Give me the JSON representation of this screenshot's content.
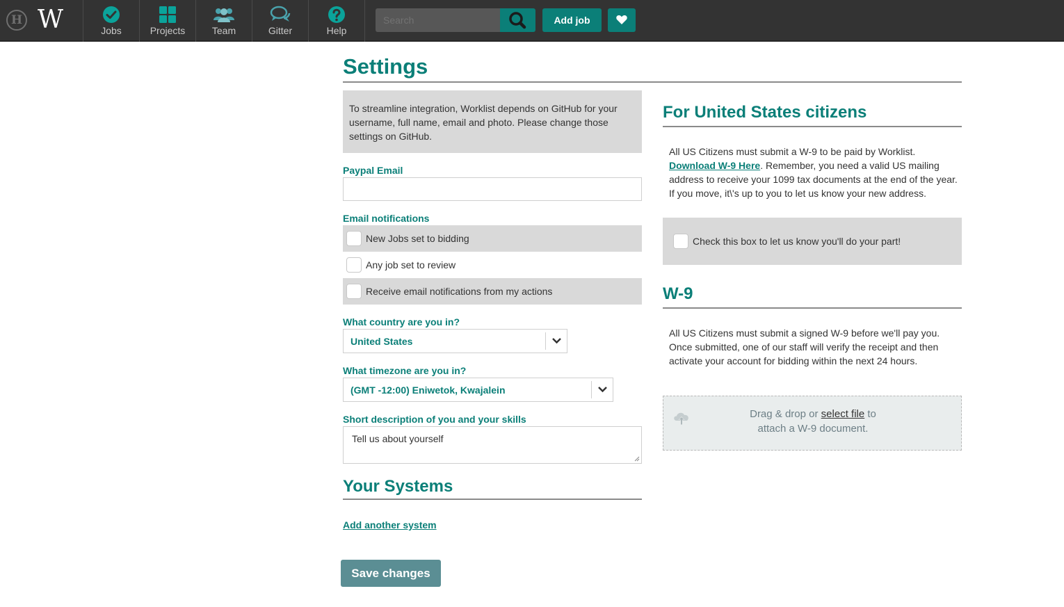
{
  "nav": {
    "items": [
      {
        "label": "Jobs",
        "icon": "check-circle-icon"
      },
      {
        "label": "Projects",
        "icon": "grid-icon"
      },
      {
        "label": "Team",
        "icon": "users-icon"
      },
      {
        "label": "Gitter",
        "icon": "chat-icon"
      },
      {
        "label": "Help",
        "icon": "question-icon"
      }
    ],
    "search_placeholder": "Search",
    "add_job_label": "Add job"
  },
  "colors": {
    "accent": "#0b7f78",
    "topbar": "#333333",
    "save_button": "#5b8e94",
    "panel_gray": "#d9d9d9"
  },
  "settings": {
    "title": "Settings",
    "info_text": "To streamline integration, Worklist depends on GitHub for your username, full name, email and photo. Please change those settings on GitHub.",
    "paypal_label": "Paypal Email",
    "paypal_value": "",
    "email_notifications_label": "Email notifications",
    "notifications": [
      {
        "label": "New Jobs set to bidding",
        "checked": false
      },
      {
        "label": "Any job set to review",
        "checked": false
      },
      {
        "label": "Receive email notifications from my actions",
        "checked": false
      }
    ],
    "country_label": "What country are you in?",
    "country_value": "United States",
    "timezone_label": "What timezone are you in?",
    "timezone_value": "(GMT -12:00) Eniwetok, Kwajalein",
    "skills_label": "Short description of you and your skills",
    "skills_value": "Tell us about yourself",
    "systems_title": "Your Systems",
    "add_system_label": "Add another system",
    "save_label": "Save changes"
  },
  "us_citizens": {
    "title": "For United States citizens",
    "text_before": "All US Citizens must submit a W-9 to be paid by Worklist.",
    "download_link": "Download W-9 Here",
    "text_after": ". Remember, you need a valid US mailing address to receive your 1099 tax documents at the end of the year. If you move, it\\'s up to you to let us know your new address.",
    "agree_label": "Check this box to let us know you'll do your part!",
    "agree_checked": false
  },
  "w9": {
    "title": "W-9",
    "text": "All US Citizens must submit a signed W-9 before we'll pay you. Once submitted, one of our staff will verify the receipt and then activate your account for bidding within the next 24 hours.",
    "drop_prefix": "Drag & drop or",
    "drop_link": "select file",
    "drop_suffix": "to",
    "drop_line2": "attach a W-9 document."
  }
}
